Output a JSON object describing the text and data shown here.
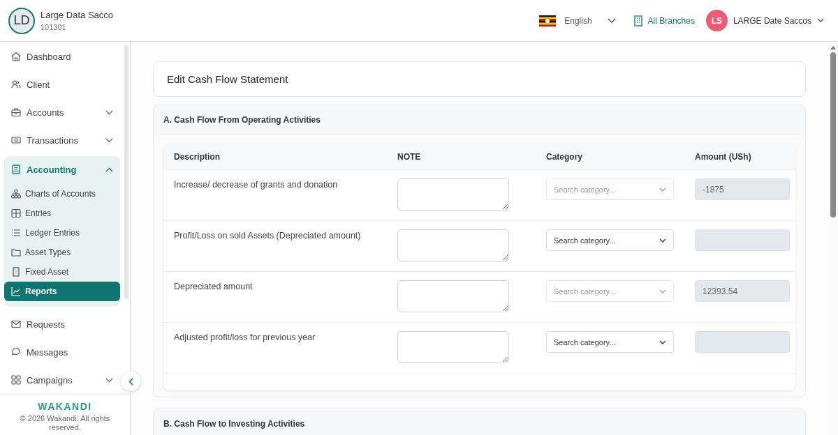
{
  "org": {
    "initials": "LD",
    "name": "Large Data Sacco",
    "code": "101301"
  },
  "topbar": {
    "language": "English",
    "branch": "All Branches",
    "user_initials": "LS",
    "user_name": "LARGE Date Saccos"
  },
  "sidebar": {
    "items": [
      {
        "label": "Dashboard",
        "selected": false
      },
      {
        "label": "Client",
        "selected": false
      },
      {
        "label": "Accounts",
        "selected": false,
        "expanded": false
      },
      {
        "label": "Transactions",
        "selected": false,
        "expanded": false
      },
      {
        "label": "Accounting",
        "selected": false,
        "expanded": true,
        "children": [
          {
            "label": "Charts of Accounts",
            "selected": false
          },
          {
            "label": "Entries",
            "selected": false
          },
          {
            "label": "Ledger Entries",
            "selected": false
          },
          {
            "label": "Asset Types",
            "selected": false
          },
          {
            "label": "Fixed Asset",
            "selected": false
          },
          {
            "label": "Reports",
            "selected": true
          }
        ]
      },
      {
        "label": "Requests",
        "selected": false
      },
      {
        "label": "Messages",
        "selected": false
      },
      {
        "label": "Campaigns",
        "selected": false,
        "expanded": false
      }
    ],
    "brand": "WAKANDI",
    "copyright": "© 2026 Wakandi. All rights reserved."
  },
  "page_title": "Edit Cash Flow Statement",
  "sections": [
    {
      "title": "A. Cash Flow From Operating Activities",
      "table": {
        "columns": [
          "Description",
          "NOTE",
          "Category",
          "Amount (USh)"
        ],
        "rows": [
          {
            "description": "Increase/ decrease of grants and donation",
            "category_placeholder": "Search category...",
            "category_disabled": true,
            "amount": "-1875"
          },
          {
            "description": "Profit/Loss on sold Assets (Depreciated amount)",
            "category_placeholder": "Search category...",
            "category_disabled": false
          },
          {
            "description": "Depreciated amount",
            "category_placeholder": "Search category...",
            "category_disabled": true,
            "amount": "12393.54"
          },
          {
            "description": "Adjusted profit/loss for previous year",
            "category_placeholder": "Search category...",
            "category_disabled": false
          }
        ]
      }
    },
    {
      "title": "B. Cash Flow to Investing Activities"
    }
  ]
}
